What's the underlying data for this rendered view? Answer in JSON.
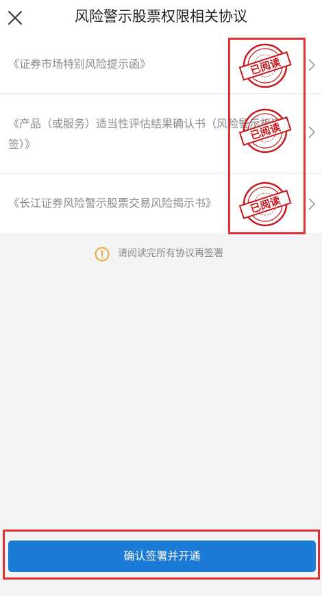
{
  "header": {
    "title": "风险警示股票权限相关协议",
    "close_icon": "close-icon"
  },
  "agreements": [
    {
      "title": "《证券市场特别风险提示函》",
      "stamp": "已阅读"
    },
    {
      "title": "《产品（或服务）适当性评估结果确认书（风险警示板网签）》",
      "stamp": "已阅读"
    },
    {
      "title": "《长江证券风险警示股票交易风险揭示书》",
      "stamp": "已阅读"
    }
  ],
  "notice": {
    "icon": "warning-circle-icon",
    "text": "请阅读完所有协议再签署"
  },
  "footer": {
    "confirm_label": "确认签署并开通"
  },
  "colors": {
    "primary": "#1c7bd6",
    "stamp": "#c8171d",
    "highlight": "#e03131",
    "notice_icon": "#f0a020"
  }
}
